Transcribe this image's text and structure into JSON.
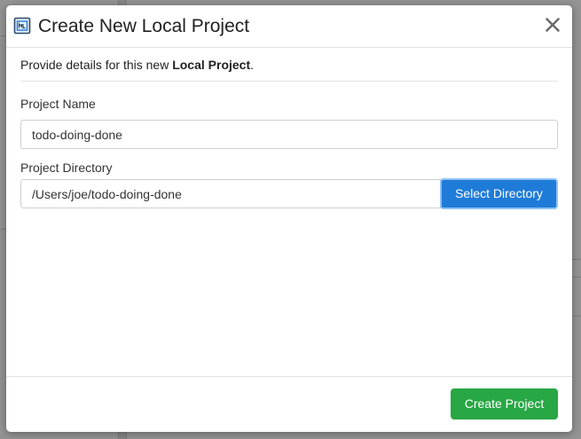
{
  "dialog": {
    "title": "Create New Local Project",
    "close_icon": "close-icon",
    "header_icon": "project-icon",
    "intro_prefix": "Provide details for this new ",
    "intro_bold": "Local Project",
    "intro_suffix": "."
  },
  "form": {
    "project_name_label": "Project Name",
    "project_name_value": "todo-doing-done",
    "project_directory_label": "Project Directory",
    "project_directory_value": "/Users/joe/todo-doing-done",
    "select_directory_label": "Select Directory"
  },
  "footer": {
    "create_label": "Create Project"
  },
  "colors": {
    "primary": "#1f7bd8",
    "success": "#28a745"
  }
}
